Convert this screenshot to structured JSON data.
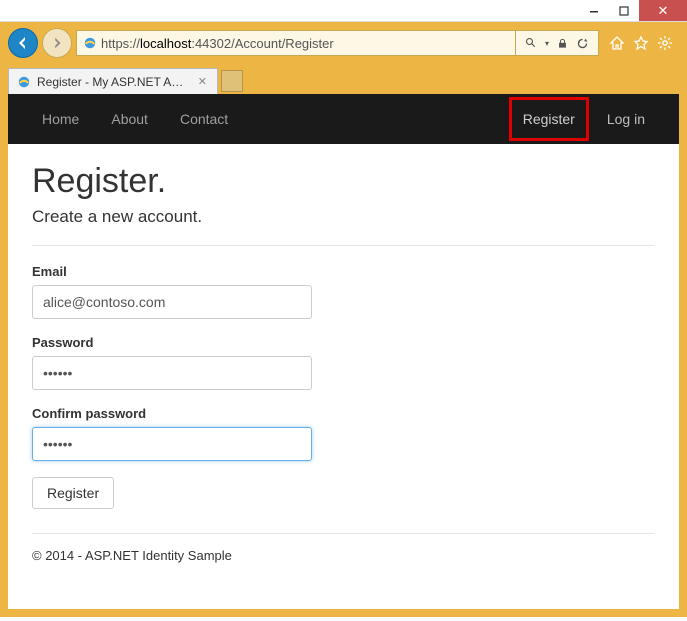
{
  "window": {
    "min": "—",
    "max": "▢",
    "close": "✕"
  },
  "browser": {
    "url_prefix": "https://",
    "url_host": "localhost",
    "url_port": ":44302",
    "url_path": "/Account/Register",
    "tab_title": "Register - My ASP.NET App...",
    "search_dropdown": "▾",
    "lock": "🔒",
    "refresh": "↻"
  },
  "nav": {
    "left": [
      "Home",
      "About",
      "Contact"
    ],
    "right": [
      "Register",
      "Log in"
    ]
  },
  "page": {
    "title": "Register.",
    "subtitle": "Create a new account.",
    "email_label": "Email",
    "email_value": "alice@contoso.com",
    "password_label": "Password",
    "password_value": "••••••",
    "confirm_label": "Confirm password",
    "confirm_value": "••••••",
    "submit_label": "Register",
    "footer": "© 2014 - ASP.NET Identity Sample"
  }
}
